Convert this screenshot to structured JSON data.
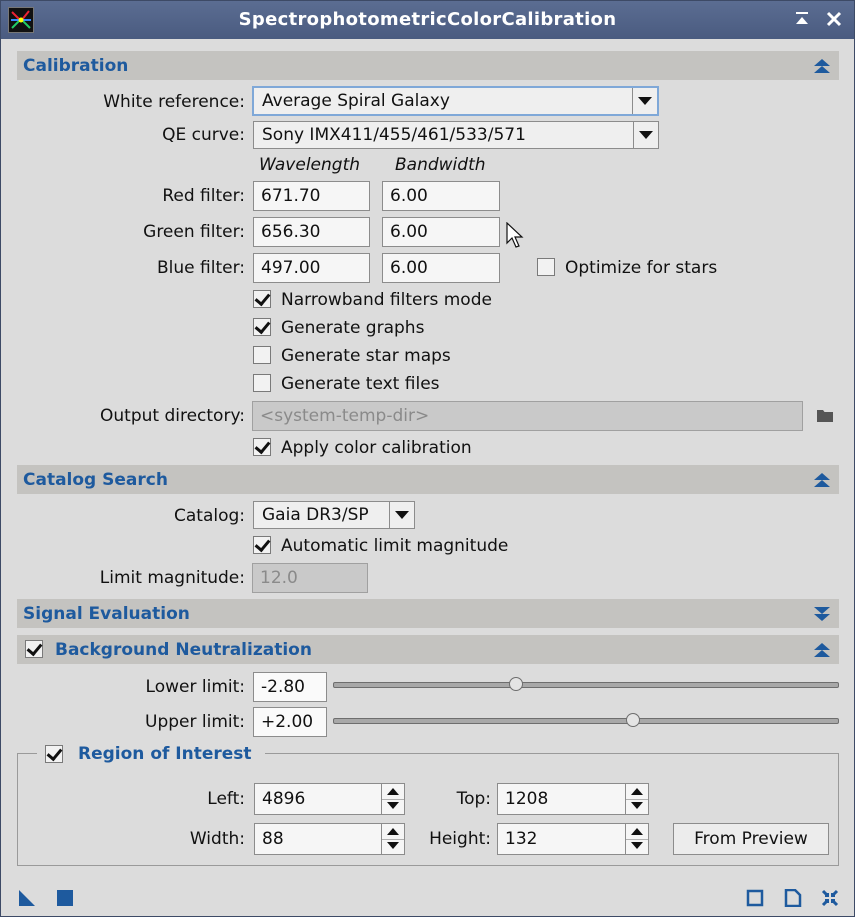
{
  "window": {
    "title": "SpectrophotometricColorCalibration"
  },
  "calibration": {
    "header": "Calibration",
    "white_reference": {
      "label": "White reference:",
      "value": "Average Spiral Galaxy"
    },
    "qe_curve": {
      "label": "QE curve:",
      "value": "Sony IMX411/455/461/533/571"
    },
    "col_wavelength": "Wavelength",
    "col_bandwidth": "Bandwidth",
    "red": {
      "label": "Red filter:",
      "wavelength": "671.70",
      "bandwidth": "6.00"
    },
    "green": {
      "label": "Green filter:",
      "wavelength": "656.30",
      "bandwidth": "6.00"
    },
    "blue": {
      "label": "Blue filter:",
      "wavelength": "497.00",
      "bandwidth": "6.00"
    },
    "optimize_for_stars": {
      "label": "Optimize for stars",
      "checked": false
    },
    "narrowband_mode": {
      "label": "Narrowband filters mode",
      "checked": true
    },
    "generate_graphs": {
      "label": "Generate graphs",
      "checked": true
    },
    "generate_star_maps": {
      "label": "Generate star maps",
      "checked": false
    },
    "generate_text_files": {
      "label": "Generate text files",
      "checked": false
    },
    "output_directory": {
      "label": "Output directory:",
      "placeholder": "<system-temp-dir>"
    },
    "apply_color_calibration": {
      "label": "Apply color calibration",
      "checked": true
    }
  },
  "catalog_search": {
    "header": "Catalog Search",
    "catalog": {
      "label": "Catalog:",
      "value": "Gaia DR3/SP"
    },
    "automatic_limit_magnitude": {
      "label": "Automatic limit magnitude",
      "checked": true
    },
    "limit_magnitude": {
      "label": "Limit magnitude:",
      "value": "12.0"
    }
  },
  "signal_evaluation": {
    "header": "Signal Evaluation"
  },
  "background_neutralization": {
    "header": "Background Neutralization",
    "enabled": true,
    "lower_limit": {
      "label": "Lower limit:",
      "value": "-2.80",
      "slider_fraction": 0.36
    },
    "upper_limit": {
      "label": "Upper limit:",
      "value": "+2.00",
      "slider_fraction": 0.59
    },
    "region_of_interest": {
      "label": "Region of Interest",
      "enabled": true,
      "left": {
        "label": "Left:",
        "value": "4896"
      },
      "top": {
        "label": "Top:",
        "value": "1208"
      },
      "width": {
        "label": "Width:",
        "value": "88"
      },
      "height": {
        "label": "Height:",
        "value": "132"
      },
      "from_preview": "From Preview"
    }
  },
  "colors": {
    "section_header_text": "#1e5a9e",
    "titlebar": "#4f6187",
    "panel_bg": "#dcdcdc"
  }
}
